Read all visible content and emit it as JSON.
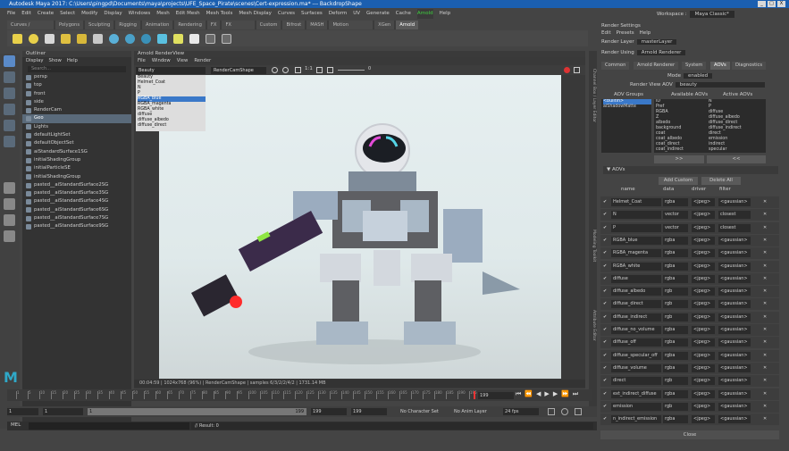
{
  "window": {
    "title": "Autodesk Maya 2017: C:\\Users\\pingpd\\Documents\\maya\\projects\\UFE_Space_Pirate\\scenes\\Cert-expression.ma* --- BackdropShape",
    "controls": [
      "_",
      "□",
      "X"
    ]
  },
  "menubar": [
    "File",
    "Edit",
    "Create",
    "Select",
    "Modify",
    "Display",
    "Windows",
    "Mesh",
    "Edit Mesh",
    "Mesh Tools",
    "Mesh Display",
    "Curves",
    "Surfaces",
    "Deform",
    "UV",
    "Generate",
    "Cache",
    "Arnold",
    "Help"
  ],
  "workspace": {
    "label": "Workspace :",
    "value": "Maya Classic*"
  },
  "shelf": {
    "tabs": [
      "Curves / Surfaces",
      "Polygons",
      "Sculpting",
      "Rigging",
      "Animation",
      "Rendering",
      "FX",
      "FX Caching",
      "Custom",
      "Bifrost",
      "MASH",
      "Motion Graphics",
      "XGen",
      "Arnold"
    ],
    "active_tab": "Arnold"
  },
  "outliner": {
    "title": "Outliner",
    "menus": [
      "Display",
      "Show",
      "Help"
    ],
    "search_placeholder": "Search...",
    "items": [
      "persp",
      "top",
      "front",
      "side",
      "RenderCam",
      "Geo",
      "Lights",
      "defaultLightSet",
      "defaultObjectSet",
      "aiStandardSurface1SG",
      "initialShadingGroup",
      "initialParticleSE",
      "initialShadingGroup",
      "pasted__aiStandardSurface2SG",
      "pasted__aiStandardSurface3SG",
      "pasted__aiStandardSurface4SG",
      "pasted__aiStandardSurface6SG",
      "pasted__aiStandardSurface7SG",
      "pasted__aiStandardSurface9SG"
    ],
    "selected_index": 5
  },
  "renderview": {
    "title": "Arnold RenderView",
    "menus": [
      "File",
      "Window",
      "View",
      "Render"
    ],
    "aov_select": "Beauty",
    "camera_select": "RenderCamShape",
    "ratio": "1:1",
    "zoom": "0",
    "aov_options": [
      "Beauty",
      "Helmet_Coat",
      "N",
      "P",
      "RGBA_blue",
      "RGBA_magenta",
      "RGBA_white",
      "diffuse",
      "diffuse_albedo",
      "diffuse_direct"
    ],
    "aov_selected_index": 4,
    "status": "00:04:59 | 1024x768 (96%) | RenderCamShape | samples 6/3/2/2/4/2 | 1731.14 MB"
  },
  "timeline": {
    "start": "1",
    "end": "199",
    "current": "199",
    "ticks": [
      "1",
      "5",
      "10",
      "15",
      "20",
      "25",
      "30",
      "35",
      "40",
      "45",
      "50",
      "55",
      "60",
      "65",
      "70",
      "75",
      "80",
      "85",
      "90",
      "95",
      "100",
      "105",
      "110",
      "115",
      "120",
      "125",
      "130",
      "135",
      "140",
      "145",
      "150",
      "155",
      "160",
      "165",
      "170",
      "175",
      "180",
      "185",
      "190",
      "195"
    ]
  },
  "range": {
    "start": "1",
    "inner_start": "1",
    "inner_end": "199",
    "end1": "199",
    "end2": "199",
    "character_set": "No Character Set",
    "anim_layer": "No Anim Layer",
    "fps": "24 fps"
  },
  "command": {
    "label": "MEL",
    "result": "// Result: 0"
  },
  "side_tabs": [
    "Channel Box / Layer Editor",
    "Modeling Toolkit",
    "Attribute Editor"
  ],
  "render_settings": {
    "title": "Render Settings",
    "menus": [
      "Edit",
      "Presets",
      "Help"
    ],
    "render_layer_label": "Render Layer",
    "render_layer": "masterLayer",
    "render_using_label": "Render Using",
    "render_using": "Arnold Renderer",
    "tabs": [
      "Common",
      "Arnold Renderer",
      "System",
      "AOVs",
      "Diagnostics"
    ],
    "active_tab": "AOVs",
    "mode_label": "Mode",
    "mode": "enabled",
    "view_aov_label": "Render View AOV",
    "view_aov": "beauty",
    "groups_header": "AOV Groups",
    "available_header": "Available AOVs",
    "active_header": "Active AOVs",
    "groups": [
      "<builtin>",
      "aiShadowMatte"
    ],
    "available": [
      "ID",
      "Pref",
      "RGBA",
      "Z",
      "albedo",
      "background",
      "coat",
      "coat_albedo",
      "coat_direct",
      "coat_indirect"
    ],
    "active": [
      "N",
      "P",
      "diffuse",
      "diffuse_albedo",
      "diffuse_direct",
      "diffuse_indirect",
      "direct",
      "emission",
      "indirect",
      "specular"
    ],
    "move_right": ">>",
    "move_left": "<<",
    "aovs_section": "AOVs",
    "add_custom": "Add Custom",
    "delete_all": "Delete All",
    "columns": [
      "name",
      "data",
      "driver",
      "filter"
    ],
    "rows": [
      {
        "name": "Helmet_Coat",
        "data": "rgba",
        "driver": "<jpeg>",
        "filter": "<gaussian>"
      },
      {
        "name": "N",
        "data": "vector",
        "driver": "<jpeg>",
        "filter": "closest"
      },
      {
        "name": "P",
        "data": "vector",
        "driver": "<jpeg>",
        "filter": "closest"
      },
      {
        "name": "RGBA_blue",
        "data": "rgba",
        "driver": "<jpeg>",
        "filter": "<gaussian>"
      },
      {
        "name": "RGBA_magenta",
        "data": "rgba",
        "driver": "<jpeg>",
        "filter": "<gaussian>"
      },
      {
        "name": "RGBA_white",
        "data": "rgba",
        "driver": "<jpeg>",
        "filter": "<gaussian>"
      },
      {
        "name": "diffuse",
        "data": "rgba",
        "driver": "<jpeg>",
        "filter": "<gaussian>"
      },
      {
        "name": "diffuse_albedo",
        "data": "rgb",
        "driver": "<jpeg>",
        "filter": "<gaussian>"
      },
      {
        "name": "diffuse_direct",
        "data": "rgb",
        "driver": "<jpeg>",
        "filter": "<gaussian>"
      },
      {
        "name": "diffuse_indirect",
        "data": "rgb",
        "driver": "<jpeg>",
        "filter": "<gaussian>"
      },
      {
        "name": "diffuse_no_volume",
        "data": "rgba",
        "driver": "<jpeg>",
        "filter": "<gaussian>"
      },
      {
        "name": "diffuse_off",
        "data": "rgba",
        "driver": "<jpeg>",
        "filter": "<gaussian>"
      },
      {
        "name": "diffuse_specular_off",
        "data": "rgba",
        "driver": "<jpeg>",
        "filter": "<gaussian>"
      },
      {
        "name": "diffuse_volume",
        "data": "rgba",
        "driver": "<jpeg>",
        "filter": "<gaussian>"
      },
      {
        "name": "direct",
        "data": "rgb",
        "driver": "<jpeg>",
        "filter": "<gaussian>"
      },
      {
        "name": "ext_indirect_diffuse",
        "data": "rgba",
        "driver": "<jpeg>",
        "filter": "<gaussian>"
      },
      {
        "name": "emission",
        "data": "rgb",
        "driver": "<jpeg>",
        "filter": "<gaussian>"
      },
      {
        "name": "n_indirect_emission",
        "data": "rgba",
        "driver": "<jpeg>",
        "filter": "<gaussian>"
      }
    ],
    "close": "Close"
  },
  "colors": {
    "accent": "#1b5fb0",
    "select": "#3a78c8",
    "arnold": "#3fd23f"
  }
}
